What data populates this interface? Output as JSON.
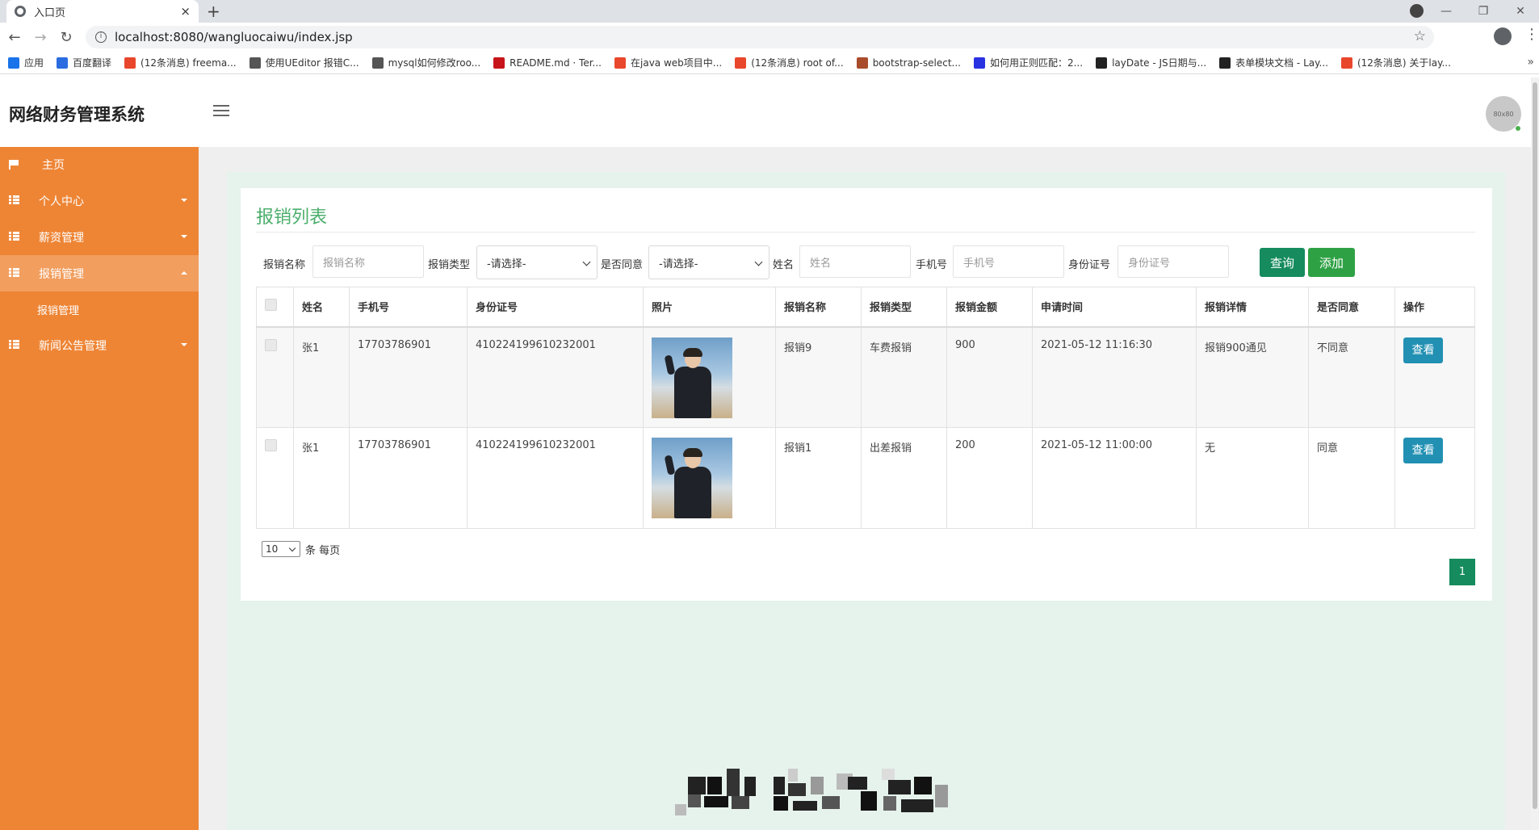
{
  "browser": {
    "tab_title": "入口页",
    "tab_close": "×",
    "new_tab": "+",
    "url": "localhost:8080/wangluocaiwu/index.jsp",
    "win_min": "—",
    "win_max": "❐",
    "win_close": "✕",
    "bookmarks": [
      {
        "label": "应用",
        "color": "#1a73e8"
      },
      {
        "label": "百度翻译",
        "color": "#2b6de0"
      },
      {
        "label": "(12条消息) freema...",
        "color": "#e8472b"
      },
      {
        "label": "使用UEditor 报错C...",
        "color": "#555555"
      },
      {
        "label": "mysql如何修改roo...",
        "color": "#555555"
      },
      {
        "label": "README.md · Ter...",
        "color": "#c7141a"
      },
      {
        "label": "在java web项目中...",
        "color": "#e8472b"
      },
      {
        "label": "(12条消息) root of...",
        "color": "#e8472b"
      },
      {
        "label": "bootstrap-select...",
        "color": "#a94c2c"
      },
      {
        "label": "如何用正则匹配：2...",
        "color": "#2932e1"
      },
      {
        "label": "layDate - JS日期与...",
        "color": "#222222"
      },
      {
        "label": "表单模块文档 - Lay...",
        "color": "#222222"
      },
      {
        "label": "(12条消息) 关于lay...",
        "color": "#e8472b"
      }
    ],
    "bookmarks_more": "»"
  },
  "app": {
    "title": "网络财务管理系统",
    "avatar_text": "80x80"
  },
  "sidebar": {
    "items": [
      {
        "label": "主页",
        "icon": "flag-icon"
      },
      {
        "label": "个人中心",
        "icon": "grid-icon"
      },
      {
        "label": "薪资管理",
        "icon": "grid-icon"
      },
      {
        "label": "报销管理",
        "icon": "grid-icon"
      },
      {
        "label": "新闻公告管理",
        "icon": "grid-icon"
      }
    ],
    "sub_item": "报销管理"
  },
  "page": {
    "title": "报销列表",
    "filters": {
      "name_label": "报销名称",
      "name_placeholder": "报销名称",
      "type_label": "报销类型",
      "type_value": "-请选择-",
      "agree_label": "是否同意",
      "agree_value": "-请选择-",
      "person_label": "姓名",
      "person_placeholder": "姓名",
      "phone_label": "手机号",
      "phone_placeholder": "手机号",
      "id_label": "身份证号",
      "id_placeholder": "身份证号",
      "query_btn": "查询",
      "add_btn": "添加"
    },
    "table": {
      "headers": [
        "姓名",
        "手机号",
        "身份证号",
        "照片",
        "报销名称",
        "报销类型",
        "报销金额",
        "申请时间",
        "报销详情",
        "是否同意",
        "操作"
      ],
      "rows": [
        {
          "name": "张1",
          "phone": "17703786901",
          "idcard": "410224199610232001",
          "title": "报销9",
          "type": "车费报销",
          "amount": "900",
          "time": "2021-05-12 11:16:30",
          "detail": "报销900通见",
          "agree": "不同意",
          "action": "查看"
        },
        {
          "name": "张1",
          "phone": "17703786901",
          "idcard": "410224199610232001",
          "title": "报销1",
          "type": "出差报销",
          "amount": "200",
          "time": "2021-05-12 11:00:00",
          "detail": "无",
          "agree": "同意",
          "action": "查看"
        }
      ]
    },
    "pager": {
      "page_size": "10",
      "per_page_label": "条 每页",
      "current_page": "1"
    }
  }
}
